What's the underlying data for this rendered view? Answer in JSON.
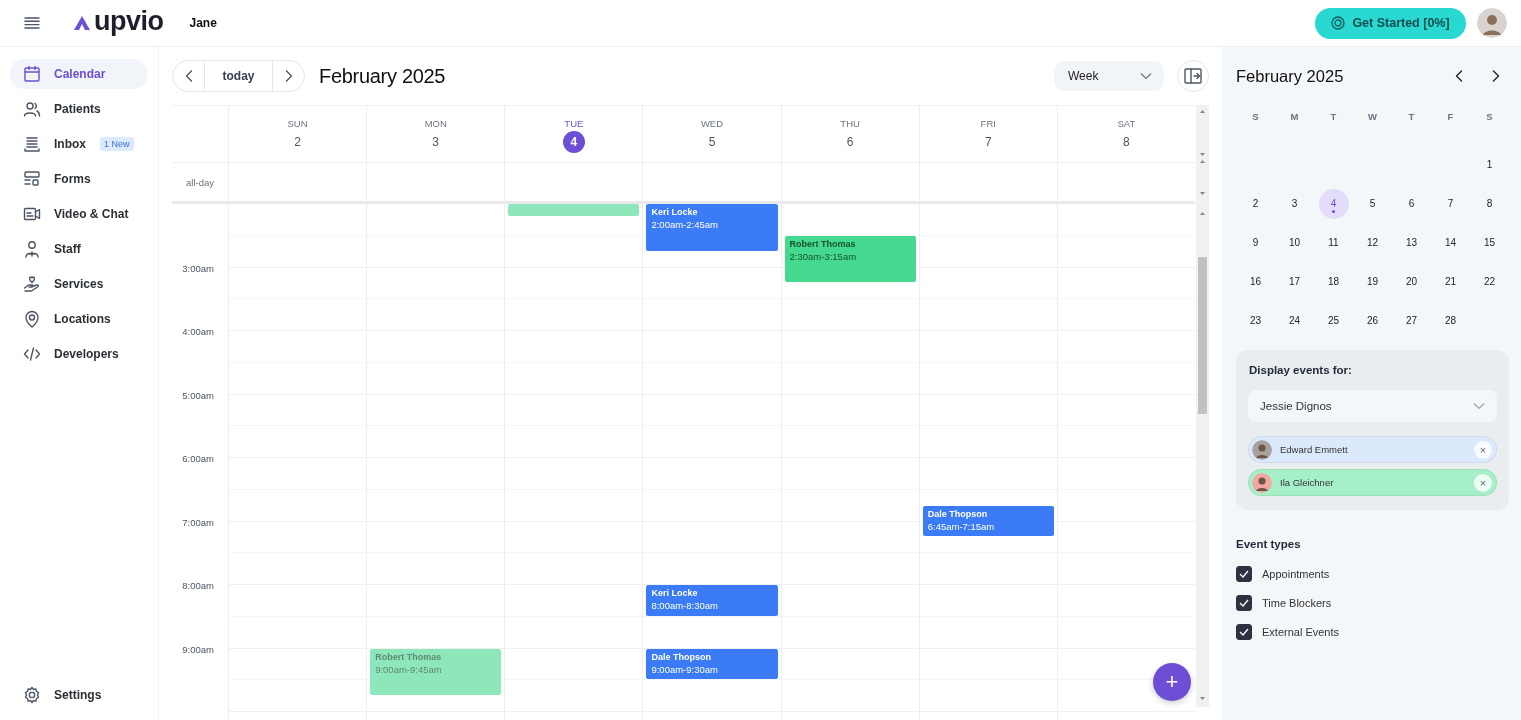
{
  "topbar": {
    "brand": "upvio",
    "user": "Jane",
    "get_started": "Get Started [0%]"
  },
  "sidebar": {
    "items": [
      {
        "label": "Calendar",
        "selected": true
      },
      {
        "label": "Patients",
        "selected": false
      },
      {
        "label": "Inbox",
        "selected": false,
        "badge": "1 New"
      },
      {
        "label": "Forms",
        "selected": false
      },
      {
        "label": "Video & Chat",
        "selected": false
      },
      {
        "label": "Staff",
        "selected": false
      },
      {
        "label": "Services",
        "selected": false
      },
      {
        "label": "Locations",
        "selected": false
      },
      {
        "label": "Developers",
        "selected": false
      }
    ],
    "footer": {
      "label": "Settings"
    }
  },
  "calendar": {
    "title": "February 2025",
    "today_button": "today",
    "view": "Week",
    "allday_label": "all-day",
    "add_button": "+",
    "time_labels": [
      "3:00am",
      "4:00am",
      "5:00am",
      "6:00am",
      "7:00am",
      "8:00am",
      "9:00am"
    ],
    "days": [
      {
        "dow": "SUN",
        "date": "2",
        "selected": false
      },
      {
        "dow": "MON",
        "date": "3",
        "selected": false,
        "events": [
          {
            "kind": "appointment",
            "name": "Robert Thomas",
            "time": "9:00am-9:45am",
            "color": "#8ee6bb",
            "past": true
          }
        ]
      },
      {
        "dow": "TUE",
        "date": "4",
        "selected": true,
        "events": [
          {
            "kind": "clipped",
            "color": "#8ee6bb"
          }
        ]
      },
      {
        "dow": "WED",
        "date": "5",
        "selected": false,
        "events": [
          {
            "kind": "appointment",
            "name": "Keri Locke",
            "time": "2:00am-2:45am",
            "color": "#3b7cf6",
            "past": false
          },
          {
            "kind": "appointment",
            "name": "Keri Locke",
            "time": "8:00am-8:30am",
            "color": "#3b7cf6",
            "past": false
          },
          {
            "kind": "appointment",
            "name": "Dale Thopson",
            "time": "9:00am-9:30am",
            "color": "#3b7cf6",
            "past": false
          }
        ]
      },
      {
        "dow": "THU",
        "date": "6",
        "selected": false,
        "events": [
          {
            "kind": "appointment",
            "name": "Robert Thomas",
            "time": "2:30am-3:15am",
            "color": "#45d98f",
            "past": false
          }
        ]
      },
      {
        "dow": "FRI",
        "date": "7",
        "selected": false,
        "events": [
          {
            "kind": "appointment",
            "name": "Dale Thopson",
            "time": "6:45am-7:15am",
            "color": "#3b7cf6",
            "past": false
          }
        ]
      },
      {
        "dow": "SAT",
        "date": "8",
        "selected": false
      }
    ]
  },
  "mini_calendar": {
    "title": "February 2025",
    "weekdays": [
      "S",
      "M",
      "T",
      "W",
      "T",
      "F",
      "S"
    ],
    "weeks": [
      [
        {
          "label": "1",
          "selected": false
        }
      ],
      [
        {
          "label": "2",
          "selected": false
        },
        {
          "label": "3",
          "selected": false
        },
        {
          "label": "4",
          "selected": true
        },
        {
          "label": "5",
          "selected": false
        },
        {
          "label": "6",
          "selected": false
        },
        {
          "label": "7",
          "selected": false
        },
        {
          "label": "8",
          "selected": false
        }
      ],
      [
        {
          "label": "9",
          "selected": false
        },
        {
          "label": "10",
          "selected": false
        },
        {
          "label": "11",
          "selected": false
        },
        {
          "label": "12",
          "selected": false
        },
        {
          "label": "13",
          "selected": false
        },
        {
          "label": "14",
          "selected": false
        },
        {
          "label": "15",
          "selected": false
        }
      ],
      [
        {
          "label": "16",
          "selected": false
        },
        {
          "label": "17",
          "selected": false
        },
        {
          "label": "18",
          "selected": false
        },
        {
          "label": "19",
          "selected": false
        },
        {
          "label": "20",
          "selected": false
        },
        {
          "label": "21",
          "selected": false
        },
        {
          "label": "22",
          "selected": false
        }
      ],
      [
        {
          "label": "23",
          "selected": false
        },
        {
          "label": "24",
          "selected": false
        },
        {
          "label": "25",
          "selected": false
        },
        {
          "label": "26",
          "selected": false
        },
        {
          "label": "27",
          "selected": false
        },
        {
          "label": "28",
          "selected": false
        }
      ]
    ]
  },
  "filter": {
    "label": "Display events for:",
    "select": "Jessie Dignos",
    "chips": [
      {
        "name": "Edward Emmett",
        "remove": "×",
        "color": "#dce8fb"
      },
      {
        "name": "Ila Gleichner",
        "remove": "×",
        "color": "#a6efc9"
      }
    ]
  },
  "event_types": {
    "title": "Event types",
    "items": [
      {
        "label": "Appointments",
        "checked": true
      },
      {
        "label": "Time Blockers",
        "checked": true
      },
      {
        "label": "External Events",
        "checked": true
      }
    ]
  }
}
